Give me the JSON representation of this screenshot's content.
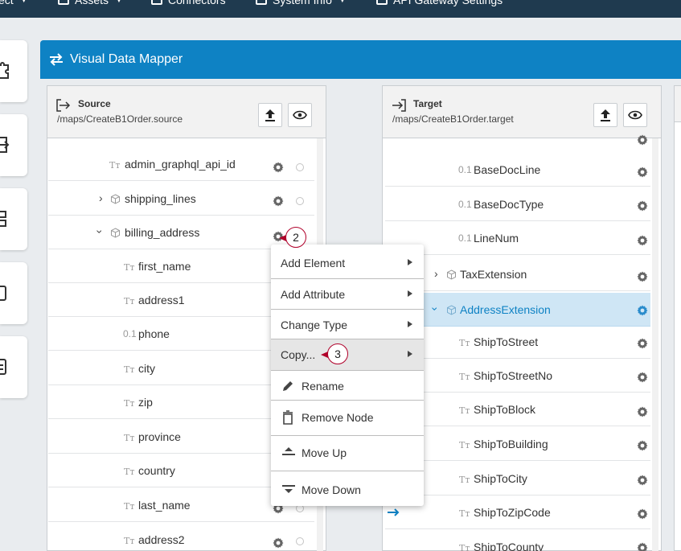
{
  "topnav": {
    "item1": "ect",
    "item2": "Assets",
    "item3": "Connectors",
    "item4": "System Info",
    "item5": "API Gateway Settings"
  },
  "mapper": {
    "title": "Visual Data Mapper"
  },
  "source": {
    "title": "Source",
    "path": "/maps/CreateB1Order.source",
    "rows": [
      "admin_graphql_api_id",
      "shipping_lines",
      "billing_address",
      "first_name",
      "address1",
      "phone",
      "city",
      "zip",
      "province",
      "country",
      "last_name",
      "address2"
    ]
  },
  "target": {
    "title": "Target",
    "path": "/maps/CreateB1Order.target",
    "rows": [
      "BaseDocLine",
      "BaseDocType",
      "LineNum",
      "TaxExtension",
      "AddressExtension",
      "ShipToStreet",
      "ShipToStreetNo",
      "ShipToBlock",
      "ShipToBuilding",
      "ShipToCity",
      "ShipToZipCode",
      "ShipToCounty"
    ]
  },
  "type_icons": {
    "text": "Tт",
    "number": "0.1"
  },
  "context_menu": {
    "add_element": "Add Element",
    "add_attribute": "Add Attribute",
    "change_type": "Change Type",
    "copy": "Copy...",
    "rename": "Rename",
    "remove_node": "Remove Node",
    "move_up": "Move Up",
    "move_down": "Move Down"
  },
  "steps": {
    "s2": "2",
    "s3": "3"
  },
  "colors": {
    "accent": "#0e82c4",
    "topbar": "#1f3a4f",
    "selected_row": "#cfe6f5",
    "step_border": "#b0002a"
  }
}
